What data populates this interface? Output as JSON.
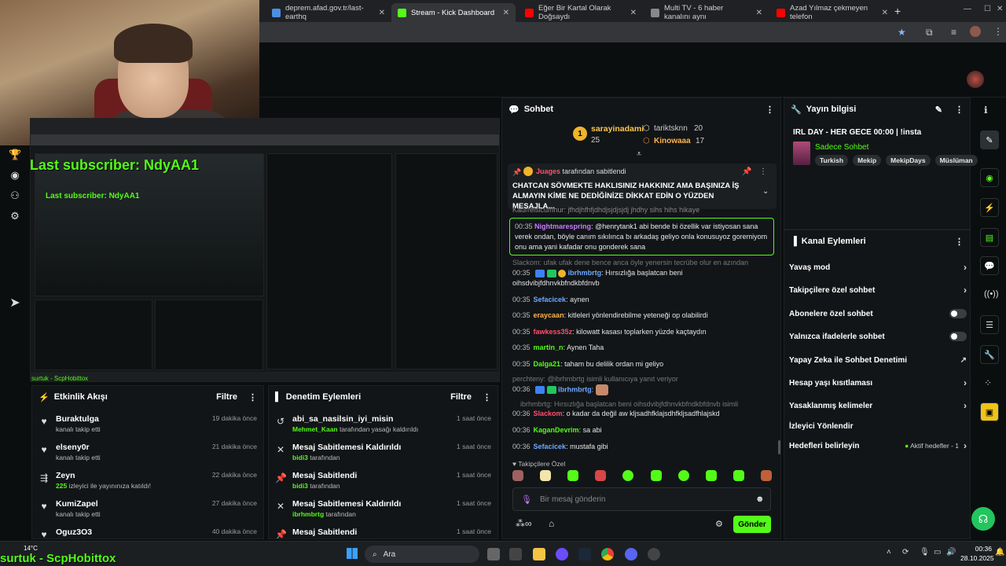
{
  "browser": {
    "tabs": [
      {
        "label": "deprem.afad.gov.tr/last-earthq",
        "color": "#4a90e2"
      },
      {
        "label": "Stream - Kick Dashboard",
        "color": "#53fc18"
      },
      {
        "label": "Eğer Bir Kartal Olarak Doğsaydı",
        "color": "#ff0000"
      },
      {
        "label": "Multi TV - 6 haber kanalını aynı",
        "color": "#888888"
      },
      {
        "label": "Azad Yılmaz çekmeyen telefon",
        "color": "#ff0000"
      }
    ],
    "new_tab": "+"
  },
  "overlay": {
    "last_subscriber": "Last subscriber: NdyAA1",
    "last_subscriber_small": "Last subscriber: NdyAA1",
    "follower_small": "surtuk - ScpHobittox",
    "follower_big": "surtuk - ScpHobittox"
  },
  "activity": {
    "title": "Etkinlik Akışı",
    "filter": "Filtre",
    "items": [
      {
        "name": "Buraktulga",
        "desc": "kanalı takip etti",
        "time": "19 dakika önce",
        "icon": "heart-icon"
      },
      {
        "name": "elseny0r",
        "desc": "kanalı takip etti",
        "time": "21 dakika önce",
        "icon": "heart-icon"
      },
      {
        "name": "Zeyn",
        "count": "225",
        "desc": "izleyici ile yayınınıza katıldı!",
        "time": "22 dakika önce",
        "icon": "raid-icon"
      },
      {
        "name": "KumiZapel",
        "desc": "kanalı takip etti",
        "time": "27 dakika önce",
        "icon": "heart-icon"
      },
      {
        "name": "Oguz3O3",
        "desc": "",
        "time": "40 dakika önce",
        "icon": "heart-icon"
      }
    ]
  },
  "moderation": {
    "title": "Denetim Eylemleri",
    "filter": "Filtre",
    "items": [
      {
        "title": "abi_sa_nasilsin_iyi_misin",
        "user": "Mehmet_Kaan",
        "desc": "tarafından yasağı kaldırıldı",
        "time": "1 saat önce",
        "icon": "unban-icon"
      },
      {
        "title": "Mesaj Sabitlemesi Kaldırıldı",
        "user": "bidi3",
        "desc": "tarafından",
        "time": "1 saat önce",
        "icon": "unpin-icon"
      },
      {
        "title": "Mesaj Sabitlendi",
        "user": "bidi3",
        "desc": "tarafından",
        "time": "1 saat önce",
        "icon": "pin-icon"
      },
      {
        "title": "Mesaj Sabitlemesi Kaldırıldı",
        "user": "ibrhmbrtg",
        "desc": "tarafından",
        "time": "1 saat önce",
        "icon": "unpin-icon"
      },
      {
        "title": "Mesaj Sabitlendi",
        "user": "",
        "desc": "",
        "time": "1 saat önce",
        "icon": "pin-icon"
      }
    ]
  },
  "chat": {
    "title": "Sohbet",
    "leaderboard": [
      {
        "rank": "1",
        "name": "sarayinadami",
        "score": "25"
      },
      {
        "rank": "",
        "name": "tariktsknn",
        "score": "20"
      },
      {
        "rank": "",
        "name": "Kinowaaa",
        "score": "17"
      }
    ],
    "pinned_by": "Juages",
    "pinned_suffix": "tarafından sabitlendi",
    "pinned_text": "CHATCAN SÖVMEKTE HAKLISINIZ HAKKINIZ AMA BAŞINIZA İŞ ALMAYIN KİME NE DEDİĞİNİZE DİKKAT EDİN O YÜZDEN MESAJLA...",
    "cut_line": "Kaurreisicumhur: jfhdjhfhfjdhdjsjdjsjdj jhdhy sihs hihs hikaye",
    "highlight": {
      "time": "00:35",
      "user": "Nightmarespring",
      "text": "@henrytank1 abi bende bi özellik var istiyosan sana verek ondan, böyle canım sıkılınca bı arkadaş geliyo onla konusuyoz goremiyom onu ama yani kafadar onu gonderek sana"
    },
    "reply_hint_1": "Slackom: ufak ufak dene bence anca öyle yenersin tecrübe olur en azından isimli...",
    "messages": [
      {
        "time": "00:35",
        "user": "ibrhmbrtg",
        "color": "#6fa8ff",
        "text": "Hırsızlığa başlatcan beni oihsdvibjfdhnvkbfndkbfdnvb"
      },
      {
        "time": "00:35",
        "user": "Sefacicek",
        "color": "#6fa8ff",
        "text": "aynen"
      },
      {
        "time": "00:35",
        "user": "eraycaan",
        "color": "#ffb347",
        "text": "kitleleri yönlendirebilme yeteneği op olabilirdi"
      },
      {
        "time": "00:35",
        "user": "fawkess35z",
        "color": "#ff4f6d",
        "text": "kilowatt kasası toplarken yüzde kaçtaydın"
      },
      {
        "time": "00:35",
        "user": "martin_n",
        "color": "#53fc18",
        "text": "Aynen Taha"
      },
      {
        "time": "00:35",
        "user": "Dalga21",
        "color": "#53fc18",
        "text": "taham bu delilik ordan mi geliyo"
      }
    ],
    "reply_hint_2": "perchteny: @ibrhmbrtg",
    "reply_hint_2b": "isimli kullanıcıya yanıt veriyor",
    "msg_ibr2": {
      "time": "00:36",
      "user": "ibrhmbrtg",
      "color": "#6fa8ff"
    },
    "reply_hint_3": "ibrhmbrtg: Hırsızlığa başlatcan beni oihsdvibjfdhnvkbfndkbfdnvb isimli kullanıcıy...",
    "messages2": [
      {
        "time": "00:36",
        "user": "Slackom",
        "color": "#ff4f6d",
        "text": "o kadar da değil aw kljsadhfklajsdhfkljsadfhlajskd"
      },
      {
        "time": "00:36",
        "user": "KaganDevrim",
        "color": "#53fc18",
        "text": "sa abi"
      },
      {
        "time": "00:36",
        "user": "Sefacicek",
        "color": "#6fa8ff",
        "text": "mustafa gibi"
      }
    ],
    "emote_section": "Takipçilere Özel",
    "input_placeholder": "Bir mesaj gönderin",
    "send": "Gönder"
  },
  "stream_info": {
    "title": "Yayın bilgisi",
    "stream_title": "IRL DAY - HER GECE 00:00 | !insta",
    "category": "Sadece Sohbet",
    "tags": [
      "Turkish",
      "Mekip",
      "MekipDays",
      "Müslüman"
    ]
  },
  "channel_actions": {
    "title": "Kanal Eylemleri",
    "rows": [
      {
        "label": "Yavaş mod",
        "kind": "chevron"
      },
      {
        "label": "Takipçilere özel sohbet",
        "kind": "chevron"
      },
      {
        "label": "Abonelere özel sohbet",
        "kind": "toggle"
      },
      {
        "label": "Yalnızca ifadelerle sohbet",
        "kind": "toggle"
      },
      {
        "label": "Yapay Zeka ile Sohbet Denetimi",
        "kind": "external"
      },
      {
        "label": "Hesap yaşı kısıtlaması",
        "kind": "chevron"
      },
      {
        "label": "Yasaklanmış kelimeler",
        "kind": "chevron"
      },
      {
        "label": "İzleyici Yönlendir",
        "kind": "none"
      },
      {
        "label": "Hedefleri belirleyin",
        "kind": "goals"
      }
    ],
    "goals_status": "Aktif hedefler - 1"
  },
  "taskbar": {
    "weather_temp": "14°C",
    "search": "Ara",
    "time": "00:36",
    "date": "28.10.2025"
  },
  "colors": {
    "accent": "#53fc18",
    "panel": "#121517",
    "bg": "#0b0e0f"
  }
}
